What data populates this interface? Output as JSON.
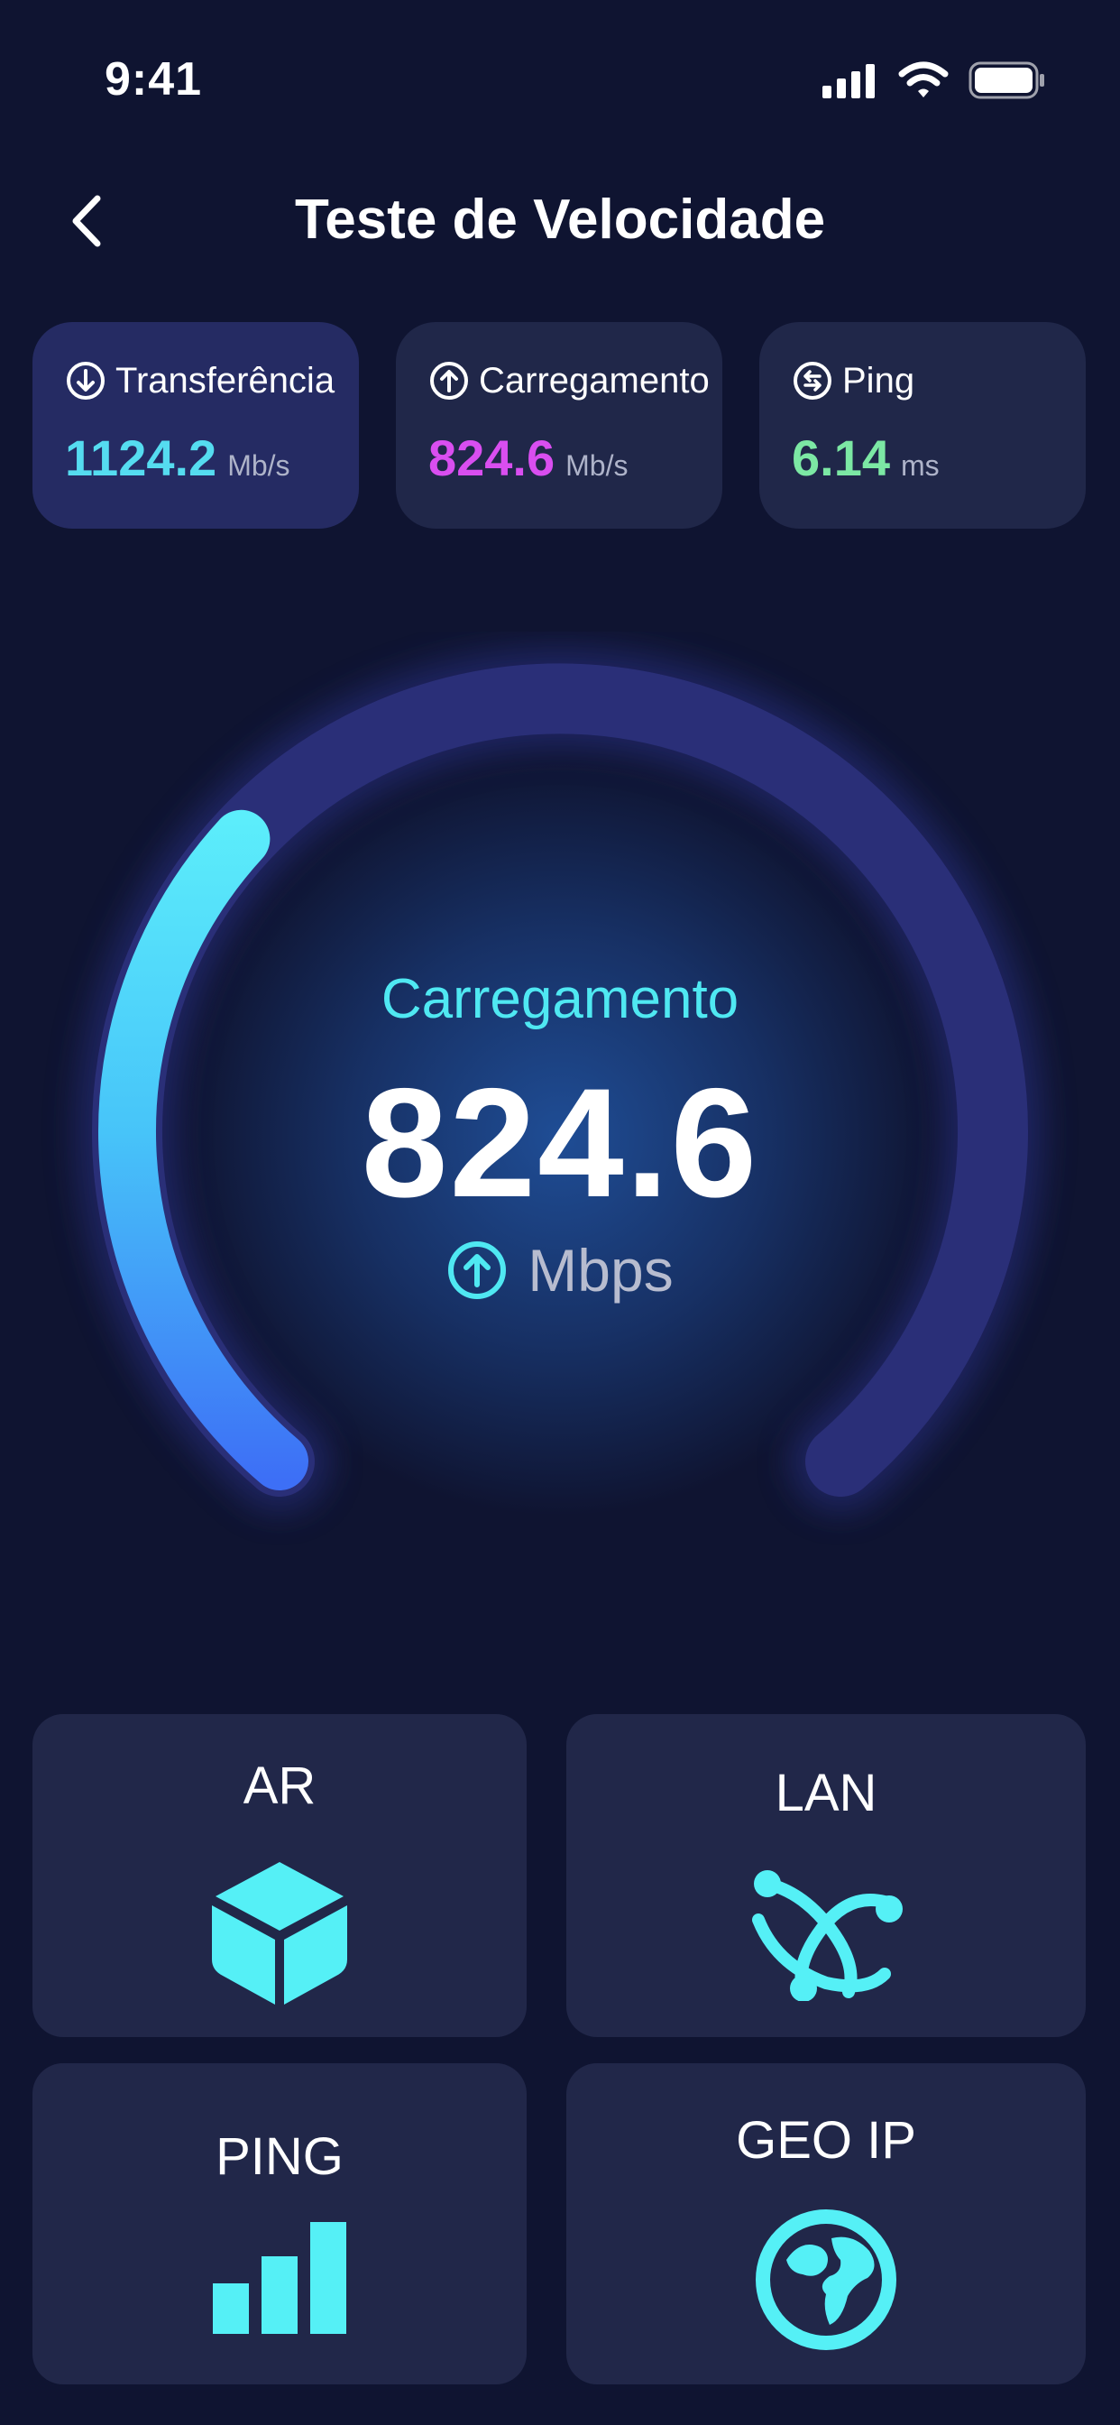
{
  "status_bar": {
    "time": "9:41"
  },
  "header": {
    "title": "Teste de Velocidade"
  },
  "stats": [
    {
      "label": "Transferência",
      "value": "1124.2",
      "unit": "Mb/s",
      "color": "#55dcf0",
      "icon": "arrow-down-circle-icon"
    },
    {
      "label": "Carregamento",
      "value": "824.6",
      "unit": "Mb/s",
      "color": "#d94ef0",
      "icon": "arrow-up-circle-icon"
    },
    {
      "label": "Ping",
      "value": "6.14",
      "unit": "ms",
      "color": "#7ce8a4",
      "icon": "swap-circle-icon"
    }
  ],
  "gauge": {
    "label": "Carregamento",
    "value": "824.6",
    "unit": "Mbps",
    "progress_fraction": 0.33,
    "accent_color": "#4fe8f2",
    "gradient_end_color": "#3d7cf7",
    "track_color": "#2a2f78"
  },
  "tools": [
    {
      "label": "AR",
      "icon": "cube-icon"
    },
    {
      "label": "LAN",
      "icon": "network-icon"
    },
    {
      "label": "PING",
      "icon": "signal-bars-icon"
    },
    {
      "label": "GEO IP",
      "icon": "globe-icon"
    }
  ],
  "colors": {
    "background": "#0f1431",
    "card": "#212749",
    "accent": "#55f0f6"
  }
}
